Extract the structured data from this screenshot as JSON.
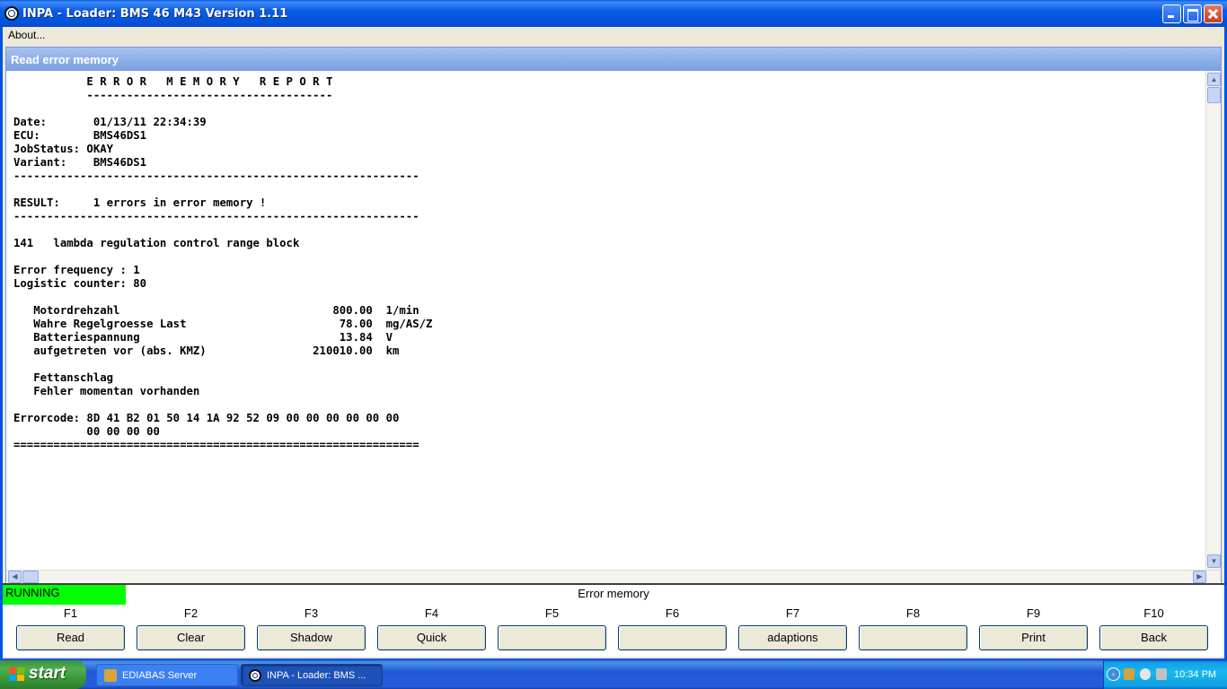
{
  "window": {
    "title": "INPA - Loader:  BMS 46 M43 Version 1.11"
  },
  "menu": {
    "about": "About..."
  },
  "child": {
    "title": "Read error memory"
  },
  "report": {
    "lines": [
      "           E R R O R   M E M O R Y   R E P O R T",
      "           -------------------------------------",
      "",
      "Date:       01/13/11 22:34:39",
      "ECU:        BMS46DS1",
      "JobStatus: OKAY",
      "Variant:    BMS46DS1",
      "-------------------------------------------------------------",
      "",
      "RESULT:     1 errors in error memory !",
      "-------------------------------------------------------------",
      "",
      "141   lambda regulation control range block",
      "",
      "Error frequency : 1",
      "Logistic counter: 80",
      "",
      "   Motordrehzahl                                800.00  1/min",
      "   Wahre Regelgroesse Last                       78.00  mg/AS/Z",
      "   Batteriespannung                              13.84  V",
      "   aufgetreten vor (abs. KMZ)                210010.00  km",
      "",
      "   Fettanschlag",
      "   Fehler momentan vorhanden",
      "",
      "Errorcode: 8D 41 B2 01 50 14 1A 92 52 09 00 00 00 00 00 00",
      "           00 00 00 00",
      "============================================================="
    ]
  },
  "status": {
    "running": "RUNNING",
    "center": "Error memory"
  },
  "fkeys": [
    {
      "key": "F1",
      "label": "Read"
    },
    {
      "key": "F2",
      "label": "Clear"
    },
    {
      "key": "F3",
      "label": "Shadow"
    },
    {
      "key": "F4",
      "label": "Quick"
    },
    {
      "key": "F5",
      "label": ""
    },
    {
      "key": "F6",
      "label": ""
    },
    {
      "key": "F7",
      "label": "adaptions"
    },
    {
      "key": "F8",
      "label": ""
    },
    {
      "key": "F9",
      "label": "Print"
    },
    {
      "key": "F10",
      "label": "Back"
    }
  ],
  "taskbar": {
    "start": "start",
    "tasks": [
      "EDIABAS Server",
      "INPA - Loader:  BMS ..."
    ],
    "clock": "10:34 PM"
  },
  "colors": {
    "running": "#00ff00",
    "titlebar": "#0054e3",
    "child_title": "#8fb1ea"
  },
  "icons": {
    "app": "bmw-logo-icon",
    "tray": [
      "chevron-left-icon",
      "ediabas-icon",
      "network-icon",
      "volume-icon"
    ]
  }
}
